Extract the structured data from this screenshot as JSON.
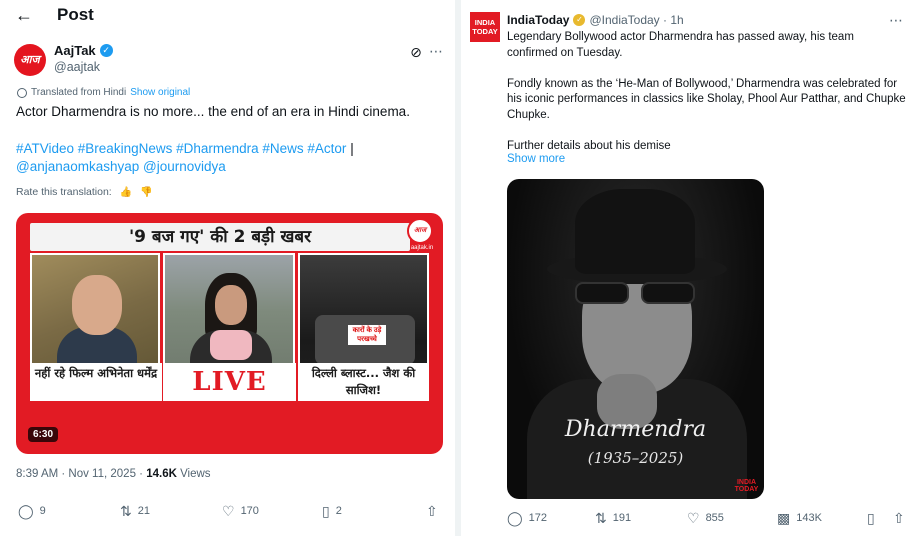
{
  "colors": {
    "accent": "#1d9bf0",
    "text": "#0f1419",
    "muted": "#536471",
    "aajtak_red": "#e21b24",
    "verified_gold": "#e8b92e"
  },
  "left": {
    "header": {
      "back_icon": "arrow-left-icon",
      "title": "Post"
    },
    "author": {
      "avatar_text": "आज तक",
      "name": "AajTak",
      "handle": "@aajtak"
    },
    "translation": {
      "label": "Translated from Hindi",
      "show_original": "Show original"
    },
    "text": "Actor Dharmendra is no more... the end of an era in Hindi cinema.",
    "hashtags_line1": "#ATVideo #BreakingNews #Dharmendra #News #Actor",
    "hashtags_sep": "|",
    "mentions_line2": "@anjanaomkashyap @journovidya",
    "rate_label": "Rate this translation:",
    "video": {
      "banner": "'9 बज गए' की 2 बड़ी खबर",
      "logo_text": "आज तक",
      "logo_url": "aajtak.in",
      "panel3_label": "कारों के उड़े परखच्चे",
      "caption1": "नहीं रहे फिल्म अभिनेता धर्मेंद्र",
      "caption2": "LIVE",
      "caption3": "दिल्ली ब्लास्ट... जैश की साजिश!",
      "duration": "6:30"
    },
    "meta": {
      "time": "8:39 AM · Nov 11, 2025 · ",
      "views_count": "14.6K",
      "views_label": " Views"
    },
    "actions": {
      "replies": "9",
      "reposts": "21",
      "likes": "170",
      "bookmarks": "2"
    }
  },
  "right": {
    "author": {
      "avatar_text": "INDIA TODAY",
      "name": "IndiaToday",
      "handle": "@IndiaToday · 1h"
    },
    "paragraphs": [
      "Legendary Bollywood actor Dharmendra has passed away, his team confirmed on Tuesday.",
      "Fondly known as the ‘He-Man of Bollywood,’ Dharmendra was celebrated for his iconic performances in classics like Sholay, Phool Aur Patthar, and Chupke Chupke.",
      "Further details about his demise"
    ],
    "show_more": "Show more",
    "image": {
      "name": "Dharmendra",
      "years": "(1935–2025)",
      "logo": "INDIA TODAY"
    },
    "actions": {
      "replies": "172",
      "reposts": "191",
      "likes": "855",
      "views": "143K"
    }
  }
}
